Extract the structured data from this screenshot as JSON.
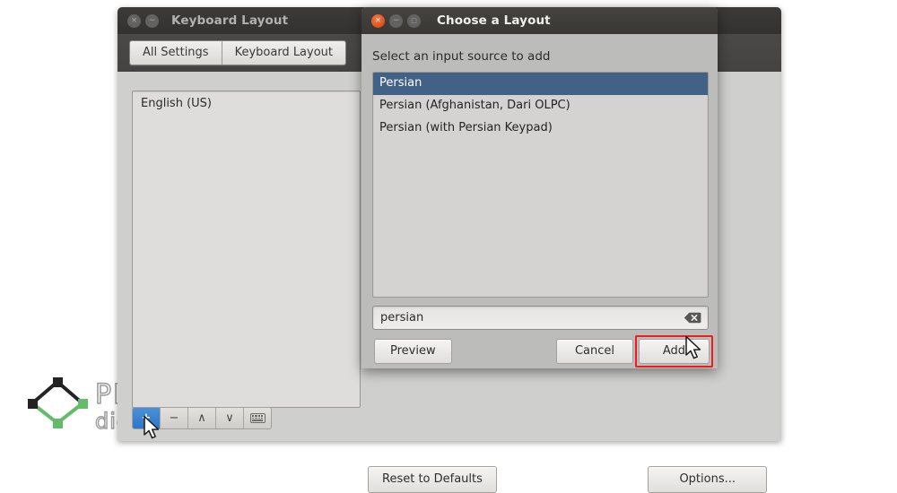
{
  "main_window": {
    "title": "Keyboard Layout",
    "window_buttons": [
      {
        "name": "close",
        "glyph": "×",
        "state": "inactive"
      },
      {
        "name": "minimize",
        "glyph": "−",
        "state": "inactive"
      }
    ],
    "tabs": [
      {
        "label": "All Settings",
        "name": "all-settings"
      },
      {
        "label": "Keyboard Layout",
        "name": "keyboard-layout"
      }
    ],
    "layout_list": {
      "items": [
        {
          "label": "English (US)"
        }
      ]
    },
    "list_toolbar": [
      {
        "name": "add-layout",
        "glyph": "+",
        "active": true
      },
      {
        "name": "remove-layout",
        "glyph": "−",
        "active": false
      },
      {
        "name": "move-up",
        "glyph": "∧",
        "active": false
      },
      {
        "name": "move-down",
        "glyph": "∨",
        "active": false
      },
      {
        "name": "show-keyboard",
        "glyph": "",
        "active": false
      }
    ],
    "reset_button": "Reset to Defaults",
    "options_button": "Options..."
  },
  "dialog": {
    "title": "Choose a Layout",
    "window_buttons": [
      {
        "name": "close",
        "glyph": "×",
        "state": "active"
      },
      {
        "name": "minimize",
        "glyph": "−",
        "state": "inactive"
      },
      {
        "name": "maximize",
        "glyph": "□",
        "state": "inactive"
      }
    ],
    "prompt": "Select an input source to add",
    "source_list": [
      {
        "label": "Persian",
        "selected": true
      },
      {
        "label": "Persian (Afghanistan, Dari OLPC)",
        "selected": false
      },
      {
        "label": "Persian (with Persian Keypad)",
        "selected": false
      }
    ],
    "search": {
      "value": "persian",
      "placeholder": "",
      "clear_icon": "clear-icon"
    },
    "buttons": {
      "preview": "Preview",
      "cancel": "Cancel",
      "add": "Add"
    }
  },
  "annotation": {
    "highlight_color": "#ee1c1c",
    "highlighted_element": "Add"
  },
  "watermark": {
    "line1": "PLAZA",
    "line2": "digital",
    "colors": {
      "dark": "#232323",
      "green": "#66bb6a"
    }
  },
  "theme": {
    "accent_blue": "#3f7fc4",
    "selection_blue": "#416187",
    "window_chrome": "#3b3a38",
    "dialog_chrome": "#45433f",
    "body_grey": "#cfcfcd",
    "dialog_grey": "#bcbcba"
  }
}
